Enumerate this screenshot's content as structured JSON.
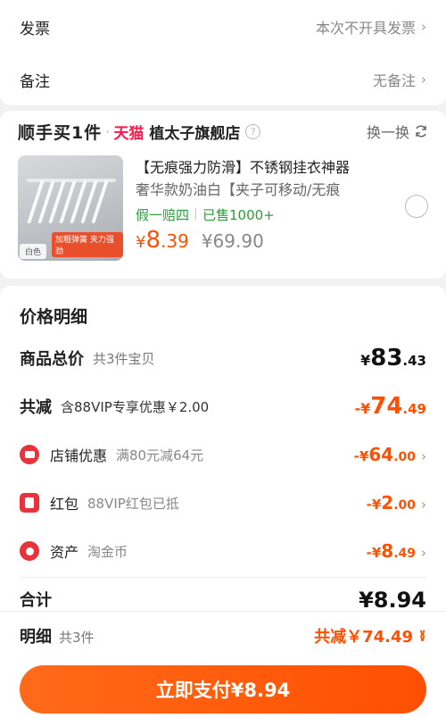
{
  "top": {
    "invoice_label": "发票",
    "invoice_value": "本次不开具发票",
    "remark_label": "备注",
    "remark_value": "无备注"
  },
  "product_card": {
    "promo_logo": "顺手买1件",
    "platform": "天猫",
    "shop_name": "植太子旗舰店",
    "help_icon": "question-icon",
    "swap_label": "换一换",
    "title": "【无痕强力防滑】不锈钢挂衣神器",
    "spec": "奢华款奶油白【夹子可移动/无痕",
    "badge_guarantee": "假一赔四",
    "badge_sold": "已售1000+",
    "price_currency": "¥",
    "price_int": "8",
    "price_dec": ".39",
    "original_price": "¥69.90",
    "thumb_tag_color": "白色",
    "thumb_tag_text": "加粗弹簧 夹力强劲"
  },
  "detail": {
    "title": "价格明细",
    "goods_total_label": "商品总价",
    "goods_total_sub": "共3件宝贝",
    "goods_total_sym": "¥",
    "goods_total_int": "83",
    "goods_total_dec": ".43",
    "discount_label": "共减",
    "discount_sub": "含88VIP专享优惠￥2.00",
    "discount_sym": "-¥",
    "discount_int": "74",
    "discount_dec": ".49",
    "items": [
      {
        "label": "店铺优惠",
        "sub": "满80元减64元",
        "sym": "-¥",
        "int": "64",
        "dec": ".00"
      },
      {
        "label": "红包",
        "sub": "88VIP红包已抵",
        "sym": "-¥",
        "int": "2",
        "dec": ".00"
      },
      {
        "label": "资产",
        "sub": "淘金币",
        "sym": "-¥",
        "int": "8",
        "dec": ".49"
      }
    ],
    "total_label": "合计",
    "total_value": "¥8.94"
  },
  "bottom": {
    "detail_label": "明细",
    "detail_count": "共3件",
    "saved_text": "共减￥74.49",
    "pay_button": "立即支付¥8.94"
  },
  "colors": {
    "accent": "#ff5000",
    "tmall_red": "#ff1a4b",
    "green": "#2a9d3a",
    "icon_red": "#e8323c"
  }
}
